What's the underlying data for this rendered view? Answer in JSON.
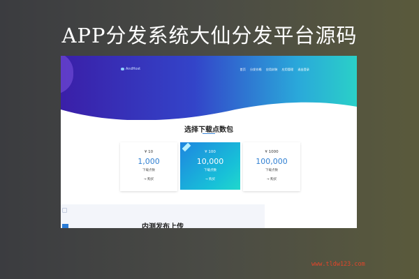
{
  "banner": {
    "title": "APP分发系统大仙分发平台源码"
  },
  "site": {
    "logo_text": "AndHost",
    "nav": [
      "首页",
      "分发价格",
      "应用封装",
      "应用管理",
      "退出登录"
    ],
    "section_title": "选择下载点数包",
    "packages": [
      {
        "price": "¥ 10",
        "count": "1,000",
        "unit": "下载点数",
        "buy": "→ 购买"
      },
      {
        "price": "¥ 100",
        "count": "10,000",
        "unit": "下载点数",
        "buy": "→ 购买",
        "featured": true
      },
      {
        "price": "¥ 1000",
        "count": "100,000",
        "unit": "下载点数",
        "buy": "→ 购买"
      }
    ],
    "next_section_title": "内测发布上传"
  },
  "watermark": "www.tldw123.com",
  "colors": {
    "hero_start": "#3a1fa8",
    "hero_end": "#2ad0c8",
    "accent": "#2f7fd2"
  }
}
